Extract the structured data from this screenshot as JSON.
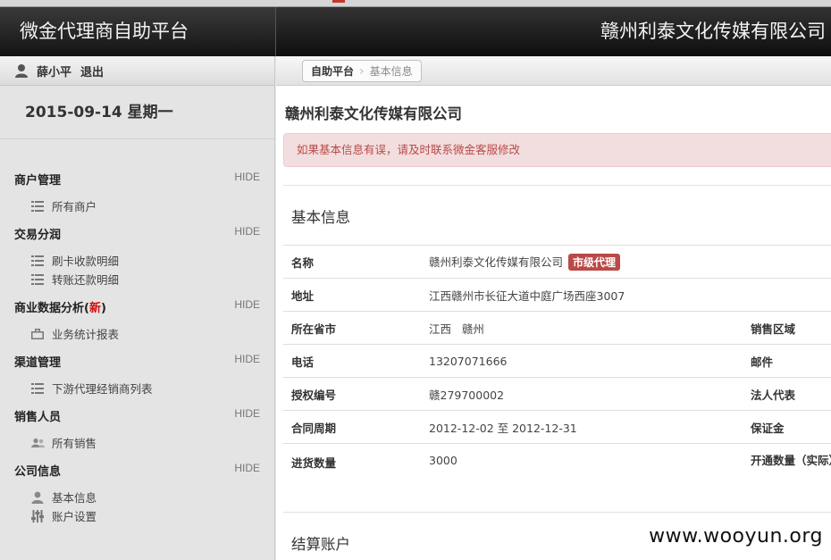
{
  "app_title": "微金代理商自助平台",
  "company_header": "赣州利泰文化传媒有限公司",
  "user": {
    "name": "薛小平",
    "logout_label": "退出"
  },
  "date": "2015-09-14 星期一",
  "nav": {
    "hide_label": "HIDE",
    "sections": [
      {
        "title": "商户管理",
        "items": [
          "所有商户"
        ]
      },
      {
        "title": "交易分润",
        "items": [
          "刷卡收款明细",
          "转账还款明细"
        ]
      },
      {
        "title_main": "商业数据分析(",
        "title_new": "新",
        "title_end": ")",
        "items": [
          "业务统计报表"
        ]
      },
      {
        "title": "渠道管理",
        "items": [
          "下游代理经销商列表"
        ]
      },
      {
        "title": "销售人员",
        "items": [
          "所有销售"
        ]
      },
      {
        "title": "公司信息",
        "items": [
          "基本信息",
          "账户设置"
        ]
      }
    ]
  },
  "breadcrumb": {
    "home": "自助平台",
    "current": "基本信息"
  },
  "main": {
    "company_name": "赣州利泰文化传媒有限公司",
    "alert": "如果基本信息有误，请及时联系微金客服修改",
    "section_basic": "基本信息",
    "section_settlement": "结算账户",
    "rows": [
      {
        "label": "名称",
        "value": "赣州利泰文化传媒有限公司",
        "badge": "市级代理",
        "label2": ""
      },
      {
        "label": "地址",
        "value": "江西赣州市长征大道中庭广场西座3007",
        "label2": ""
      },
      {
        "label": "所在省市",
        "value": "江西   赣州",
        "label2": "销售区域"
      },
      {
        "label": "电话",
        "value": "13207071666",
        "label2": "邮件"
      },
      {
        "label": "授权编号",
        "value": "赣279700002",
        "label2": "法人代表"
      },
      {
        "label": "合同周期",
        "value": "2012-12-02 至 2012-12-31",
        "label2": "保证金"
      },
      {
        "label": "进货数量",
        "value": "3000",
        "label2": "开通数量（实际）"
      }
    ]
  },
  "watermark": "www.wooyun.org",
  "colors": {
    "alert_bg": "#f2dede",
    "alert_text": "#b94a48",
    "badge_bg": "#b94a48",
    "header_bg": "#1a1a1a"
  }
}
